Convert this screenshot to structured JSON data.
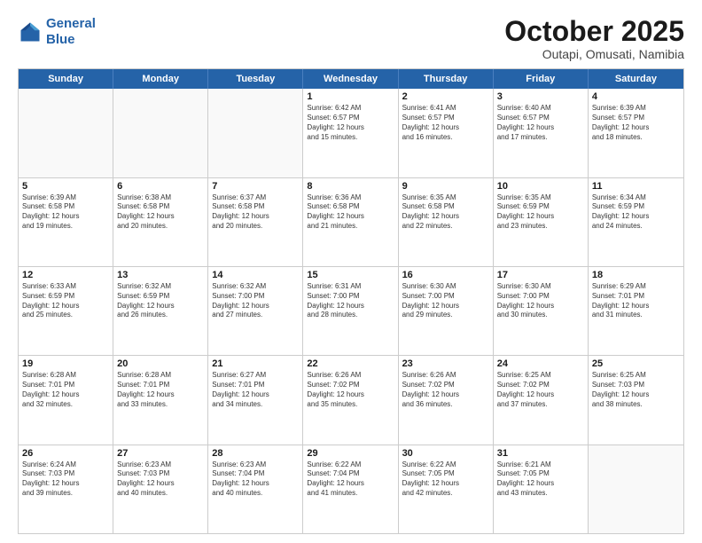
{
  "header": {
    "logo_line1": "General",
    "logo_line2": "Blue",
    "month": "October 2025",
    "location": "Outapi, Omusati, Namibia"
  },
  "weekdays": [
    "Sunday",
    "Monday",
    "Tuesday",
    "Wednesday",
    "Thursday",
    "Friday",
    "Saturday"
  ],
  "rows": [
    [
      {
        "day": "",
        "info": ""
      },
      {
        "day": "",
        "info": ""
      },
      {
        "day": "",
        "info": ""
      },
      {
        "day": "1",
        "info": "Sunrise: 6:42 AM\nSunset: 6:57 PM\nDaylight: 12 hours\nand 15 minutes."
      },
      {
        "day": "2",
        "info": "Sunrise: 6:41 AM\nSunset: 6:57 PM\nDaylight: 12 hours\nand 16 minutes."
      },
      {
        "day": "3",
        "info": "Sunrise: 6:40 AM\nSunset: 6:57 PM\nDaylight: 12 hours\nand 17 minutes."
      },
      {
        "day": "4",
        "info": "Sunrise: 6:39 AM\nSunset: 6:57 PM\nDaylight: 12 hours\nand 18 minutes."
      }
    ],
    [
      {
        "day": "5",
        "info": "Sunrise: 6:39 AM\nSunset: 6:58 PM\nDaylight: 12 hours\nand 19 minutes."
      },
      {
        "day": "6",
        "info": "Sunrise: 6:38 AM\nSunset: 6:58 PM\nDaylight: 12 hours\nand 20 minutes."
      },
      {
        "day": "7",
        "info": "Sunrise: 6:37 AM\nSunset: 6:58 PM\nDaylight: 12 hours\nand 20 minutes."
      },
      {
        "day": "8",
        "info": "Sunrise: 6:36 AM\nSunset: 6:58 PM\nDaylight: 12 hours\nand 21 minutes."
      },
      {
        "day": "9",
        "info": "Sunrise: 6:35 AM\nSunset: 6:58 PM\nDaylight: 12 hours\nand 22 minutes."
      },
      {
        "day": "10",
        "info": "Sunrise: 6:35 AM\nSunset: 6:59 PM\nDaylight: 12 hours\nand 23 minutes."
      },
      {
        "day": "11",
        "info": "Sunrise: 6:34 AM\nSunset: 6:59 PM\nDaylight: 12 hours\nand 24 minutes."
      }
    ],
    [
      {
        "day": "12",
        "info": "Sunrise: 6:33 AM\nSunset: 6:59 PM\nDaylight: 12 hours\nand 25 minutes."
      },
      {
        "day": "13",
        "info": "Sunrise: 6:32 AM\nSunset: 6:59 PM\nDaylight: 12 hours\nand 26 minutes."
      },
      {
        "day": "14",
        "info": "Sunrise: 6:32 AM\nSunset: 7:00 PM\nDaylight: 12 hours\nand 27 minutes."
      },
      {
        "day": "15",
        "info": "Sunrise: 6:31 AM\nSunset: 7:00 PM\nDaylight: 12 hours\nand 28 minutes."
      },
      {
        "day": "16",
        "info": "Sunrise: 6:30 AM\nSunset: 7:00 PM\nDaylight: 12 hours\nand 29 minutes."
      },
      {
        "day": "17",
        "info": "Sunrise: 6:30 AM\nSunset: 7:00 PM\nDaylight: 12 hours\nand 30 minutes."
      },
      {
        "day": "18",
        "info": "Sunrise: 6:29 AM\nSunset: 7:01 PM\nDaylight: 12 hours\nand 31 minutes."
      }
    ],
    [
      {
        "day": "19",
        "info": "Sunrise: 6:28 AM\nSunset: 7:01 PM\nDaylight: 12 hours\nand 32 minutes."
      },
      {
        "day": "20",
        "info": "Sunrise: 6:28 AM\nSunset: 7:01 PM\nDaylight: 12 hours\nand 33 minutes."
      },
      {
        "day": "21",
        "info": "Sunrise: 6:27 AM\nSunset: 7:01 PM\nDaylight: 12 hours\nand 34 minutes."
      },
      {
        "day": "22",
        "info": "Sunrise: 6:26 AM\nSunset: 7:02 PM\nDaylight: 12 hours\nand 35 minutes."
      },
      {
        "day": "23",
        "info": "Sunrise: 6:26 AM\nSunset: 7:02 PM\nDaylight: 12 hours\nand 36 minutes."
      },
      {
        "day": "24",
        "info": "Sunrise: 6:25 AM\nSunset: 7:02 PM\nDaylight: 12 hours\nand 37 minutes."
      },
      {
        "day": "25",
        "info": "Sunrise: 6:25 AM\nSunset: 7:03 PM\nDaylight: 12 hours\nand 38 minutes."
      }
    ],
    [
      {
        "day": "26",
        "info": "Sunrise: 6:24 AM\nSunset: 7:03 PM\nDaylight: 12 hours\nand 39 minutes."
      },
      {
        "day": "27",
        "info": "Sunrise: 6:23 AM\nSunset: 7:03 PM\nDaylight: 12 hours\nand 40 minutes."
      },
      {
        "day": "28",
        "info": "Sunrise: 6:23 AM\nSunset: 7:04 PM\nDaylight: 12 hours\nand 40 minutes."
      },
      {
        "day": "29",
        "info": "Sunrise: 6:22 AM\nSunset: 7:04 PM\nDaylight: 12 hours\nand 41 minutes."
      },
      {
        "day": "30",
        "info": "Sunrise: 6:22 AM\nSunset: 7:05 PM\nDaylight: 12 hours\nand 42 minutes."
      },
      {
        "day": "31",
        "info": "Sunrise: 6:21 AM\nSunset: 7:05 PM\nDaylight: 12 hours\nand 43 minutes."
      },
      {
        "day": "",
        "info": ""
      }
    ]
  ]
}
